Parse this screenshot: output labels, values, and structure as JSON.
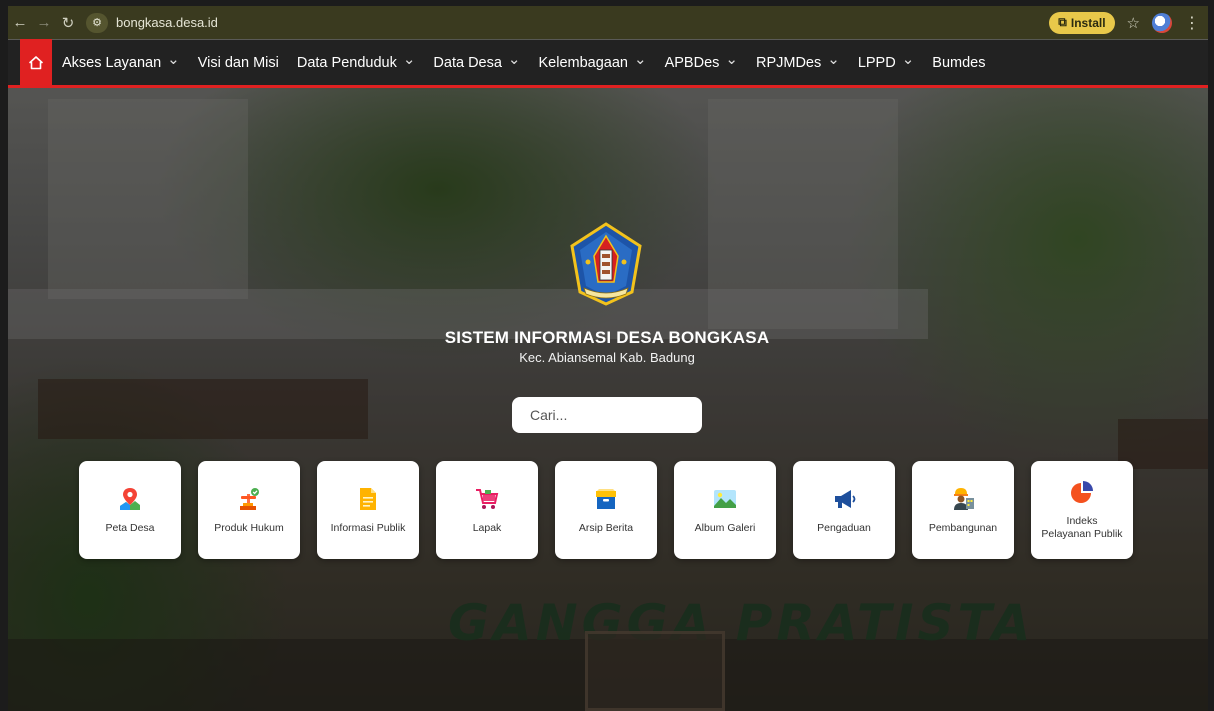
{
  "browser": {
    "url": "bongkasa.desa.id",
    "install_label": "Install"
  },
  "nav": {
    "home_icon": "home-icon",
    "items": [
      {
        "label": "Akses Layanan",
        "dropdown": true
      },
      {
        "label": "Visi dan Misi",
        "dropdown": false
      },
      {
        "label": "Data Penduduk",
        "dropdown": true
      },
      {
        "label": "Data Desa",
        "dropdown": true
      },
      {
        "label": "Kelembagaan",
        "dropdown": true
      },
      {
        "label": "APBDes",
        "dropdown": true
      },
      {
        "label": "RPJMDes",
        "dropdown": true
      },
      {
        "label": "LPPD",
        "dropdown": true
      },
      {
        "label": "Bumdes",
        "dropdown": false
      }
    ],
    "accent_color": "#e02121"
  },
  "hero": {
    "title": "SISTEM INFORMASI DESA BONGKASA",
    "subtitle": "Kec. Abiansemal Kab. Badung",
    "search_placeholder": "Cari...",
    "wall_text": "GANGGA PRATISTA"
  },
  "cards": [
    {
      "label": "Peta Desa",
      "icon": "map-pin-icon"
    },
    {
      "label": "Produk Hukum",
      "icon": "gavel-icon"
    },
    {
      "label": "Informasi Publik",
      "icon": "document-icon"
    },
    {
      "label": "Lapak",
      "icon": "shopping-cart-icon"
    },
    {
      "label": "Arsip Berita",
      "icon": "archive-box-icon"
    },
    {
      "label": "Album Galeri",
      "icon": "image-gallery-icon"
    },
    {
      "label": "Pengaduan",
      "icon": "megaphone-icon"
    },
    {
      "label": "Pembangunan",
      "icon": "construction-worker-icon"
    },
    {
      "label": "Indeks Pelayanan Publik",
      "icon": "pie-chart-icon"
    }
  ]
}
